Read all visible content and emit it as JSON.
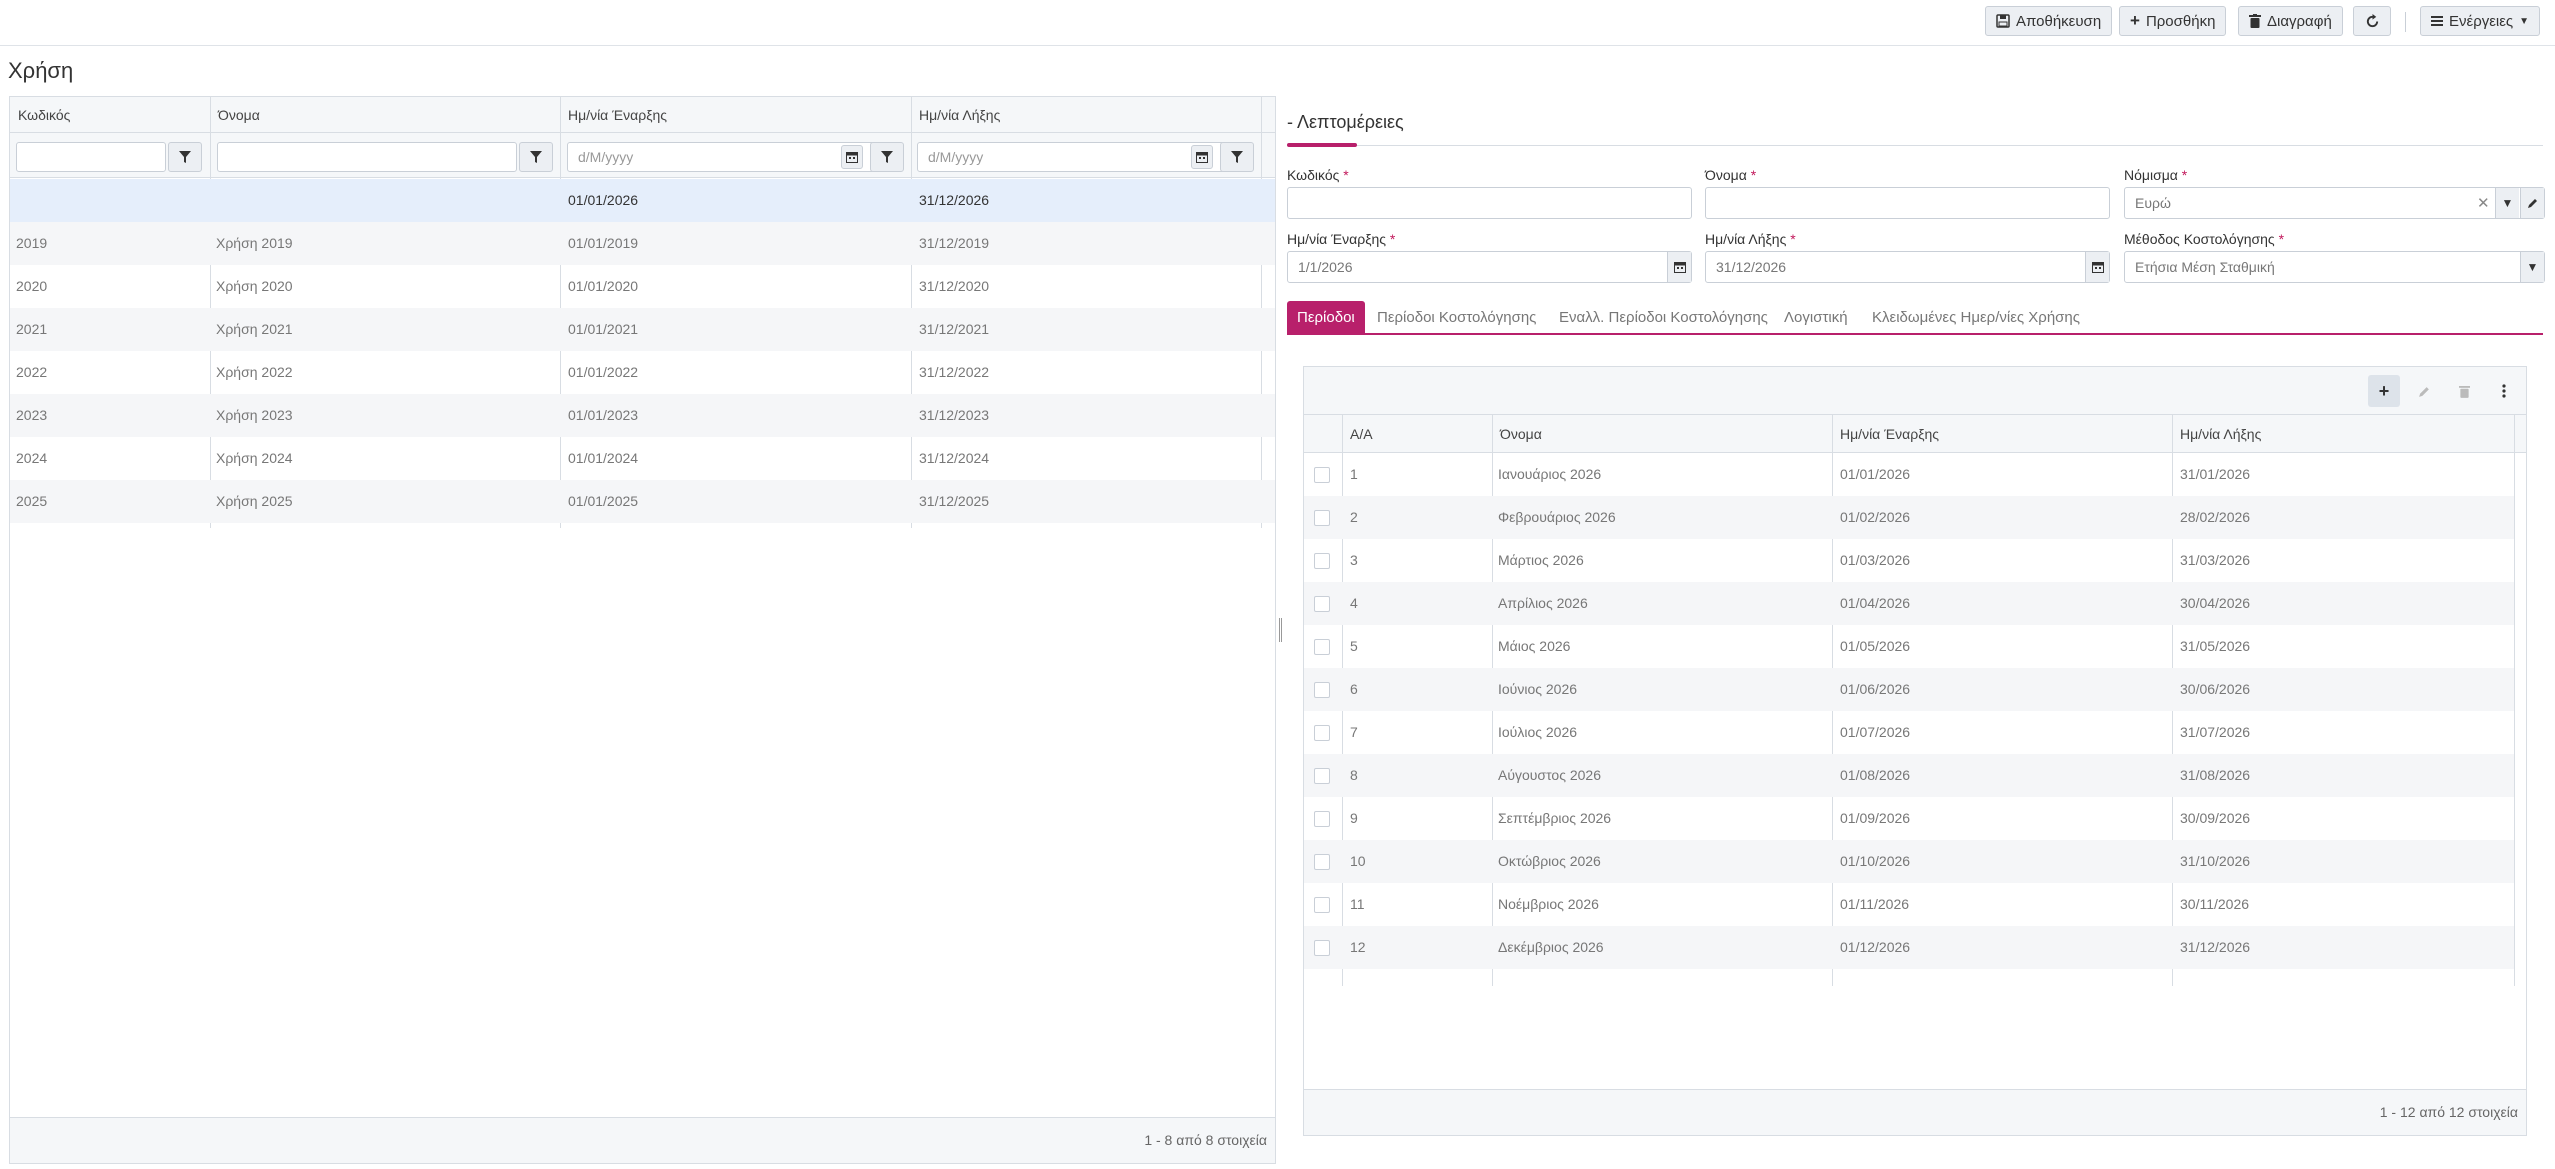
{
  "toolbar": {
    "save": "Αποθήκευση",
    "add": "Προσθήκη",
    "delete": "Διαγραφή",
    "actions": "Ενέργειες"
  },
  "page": {
    "title": "Χρήση"
  },
  "left_grid": {
    "columns": [
      "Κωδικός",
      "Όνομα",
      "Ημ/νία Έναρξης",
      "Ημ/νία Λήξης"
    ],
    "date_placeholder": "d/M/yyyy",
    "rows": [
      {
        "code": "",
        "name": "",
        "start": "01/01/2026",
        "end": "31/12/2026"
      },
      {
        "code": "2019",
        "name": "Χρήση 2019",
        "start": "01/01/2019",
        "end": "31/12/2019"
      },
      {
        "code": "2020",
        "name": "Χρήση 2020",
        "start": "01/01/2020",
        "end": "31/12/2020"
      },
      {
        "code": "2021",
        "name": "Χρήση 2021",
        "start": "01/01/2021",
        "end": "31/12/2021"
      },
      {
        "code": "2022",
        "name": "Χρήση 2022",
        "start": "01/01/2022",
        "end": "31/12/2022"
      },
      {
        "code": "2023",
        "name": "Χρήση 2023",
        "start": "01/01/2023",
        "end": "31/12/2023"
      },
      {
        "code": "2024",
        "name": "Χρήση 2024",
        "start": "01/01/2024",
        "end": "31/12/2024"
      },
      {
        "code": "2025",
        "name": "Χρήση 2025",
        "start": "01/01/2025",
        "end": "31/12/2025"
      }
    ],
    "footer": "1 - 8 από 8 στοιχεία"
  },
  "detail": {
    "title": "- Λεπτομέρειες",
    "required_mark": "*",
    "fields": {
      "code_label": "Κωδικός",
      "code_value": "",
      "name_label": "Όνομα",
      "name_value": "",
      "currency_label": "Νόμισμα",
      "currency_value": "Ευρώ",
      "start_label": "Ημ/νία Έναρξης",
      "start_value": "1/1/2026",
      "end_label": "Ημ/νία Λήξης",
      "end_value": "31/12/2026",
      "method_label": "Μέθοδος Κοστολόγησης",
      "method_value": "Ετήσια Μέση Σταθμική"
    },
    "tabs": [
      "Περίοδοι",
      "Περίοδοι Κοστολόγησης",
      "Εναλλ. Περίοδοι Κοστολόγησης",
      "Λογιστική",
      "Κλειδωμένες Ημερ/νίες Χρήσης"
    ],
    "active_tab": "Περίοδοι"
  },
  "periods": {
    "columns": [
      "Α/Α",
      "Όνομα",
      "Ημ/νία Έναρξης",
      "Ημ/νία Λήξης"
    ],
    "rows": [
      {
        "no": "1",
        "name": "Ιανουάριος 2026",
        "start": "01/01/2026",
        "end": "31/01/2026"
      },
      {
        "no": "2",
        "name": "Φεβρουάριος 2026",
        "start": "01/02/2026",
        "end": "28/02/2026"
      },
      {
        "no": "3",
        "name": "Μάρτιος 2026",
        "start": "01/03/2026",
        "end": "31/03/2026"
      },
      {
        "no": "4",
        "name": "Απρίλιος 2026",
        "start": "01/04/2026",
        "end": "30/04/2026"
      },
      {
        "no": "5",
        "name": "Μάιος 2026",
        "start": "01/05/2026",
        "end": "31/05/2026"
      },
      {
        "no": "6",
        "name": "Ιούνιος 2026",
        "start": "01/06/2026",
        "end": "30/06/2026"
      },
      {
        "no": "7",
        "name": "Ιούλιος 2026",
        "start": "01/07/2026",
        "end": "31/07/2026"
      },
      {
        "no": "8",
        "name": "Αύγουστος 2026",
        "start": "01/08/2026",
        "end": "31/08/2026"
      },
      {
        "no": "9",
        "name": "Σεπτέμβριος 2026",
        "start": "01/09/2026",
        "end": "30/09/2026"
      },
      {
        "no": "10",
        "name": "Οκτώβριος 2026",
        "start": "01/10/2026",
        "end": "31/10/2026"
      },
      {
        "no": "11",
        "name": "Νοέμβριος 2026",
        "start": "01/11/2026",
        "end": "30/11/2026"
      },
      {
        "no": "12",
        "name": "Δεκέμβριος 2026",
        "start": "01/12/2026",
        "end": "31/12/2026"
      }
    ],
    "footer": "1 - 12 από 12 στοιχεία"
  },
  "colors": {
    "accent": "#b8206b",
    "selected_row": "#e5eefb"
  }
}
